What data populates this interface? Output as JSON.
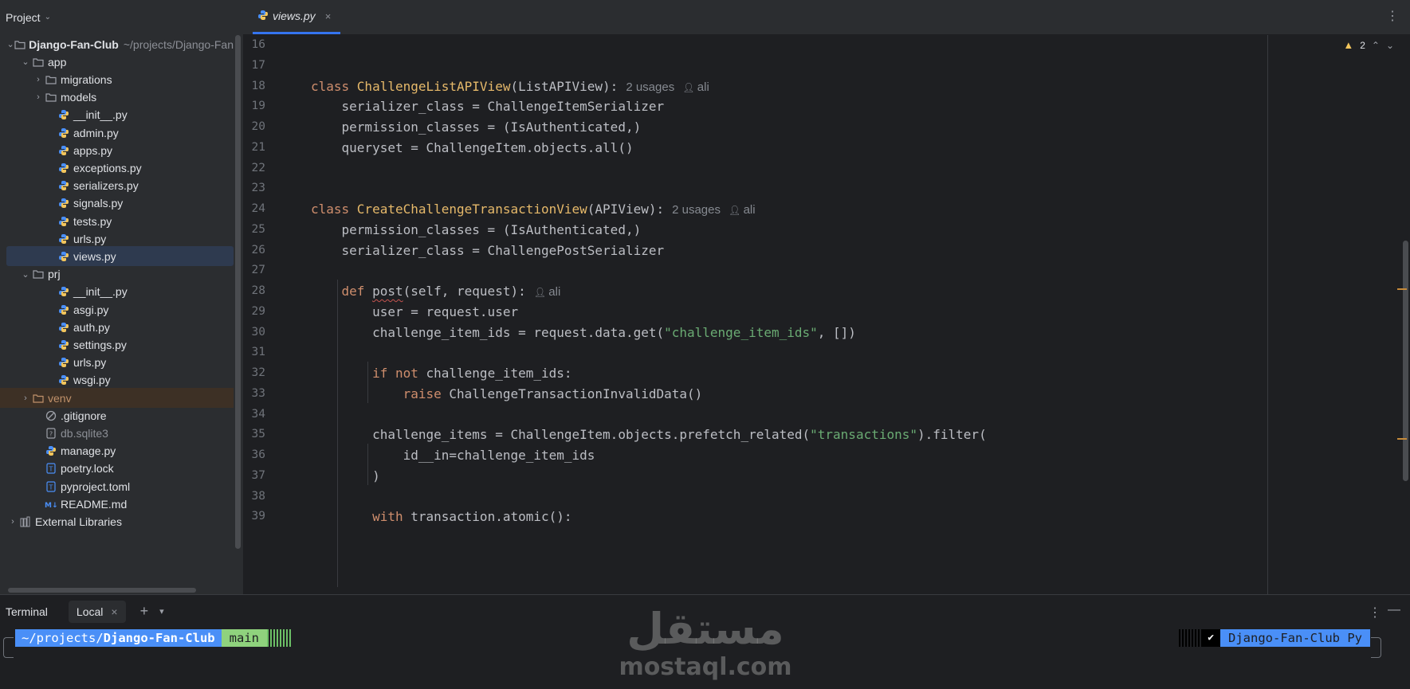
{
  "project_panel": {
    "title": "Project",
    "tree": [
      {
        "label": "Django-Fan-Club",
        "path": "~/projects/Django-Fan",
        "type": "folder",
        "expanded": true,
        "indent": 0
      },
      {
        "label": "app",
        "type": "folder",
        "expanded": true,
        "indent": 1
      },
      {
        "label": "migrations",
        "type": "folder",
        "expanded": false,
        "indent": 2
      },
      {
        "label": "models",
        "type": "folder",
        "expanded": false,
        "indent": 2
      },
      {
        "label": "__init__.py",
        "type": "python",
        "indent": 3
      },
      {
        "label": "admin.py",
        "type": "python",
        "indent": 3
      },
      {
        "label": "apps.py",
        "type": "python",
        "indent": 3
      },
      {
        "label": "exceptions.py",
        "type": "python",
        "indent": 3
      },
      {
        "label": "serializers.py",
        "type": "python",
        "indent": 3
      },
      {
        "label": "signals.py",
        "type": "python",
        "indent": 3
      },
      {
        "label": "tests.py",
        "type": "python",
        "indent": 3
      },
      {
        "label": "urls.py",
        "type": "python",
        "indent": 3
      },
      {
        "label": "views.py",
        "type": "python",
        "indent": 3,
        "selected": true
      },
      {
        "label": "prj",
        "type": "folder",
        "expanded": true,
        "indent": 1
      },
      {
        "label": "__init__.py",
        "type": "python",
        "indent": 3
      },
      {
        "label": "asgi.py",
        "type": "python",
        "indent": 3
      },
      {
        "label": "auth.py",
        "type": "python",
        "indent": 3
      },
      {
        "label": "settings.py",
        "type": "python",
        "indent": 3
      },
      {
        "label": "urls.py",
        "type": "python",
        "indent": 3
      },
      {
        "label": "wsgi.py",
        "type": "python",
        "indent": 3
      },
      {
        "label": "venv",
        "type": "excluded-folder",
        "expanded": false,
        "indent": 1
      },
      {
        "label": ".gitignore",
        "type": "ignore",
        "indent": 2
      },
      {
        "label": "db.sqlite3",
        "type": "db",
        "indent": 2
      },
      {
        "label": "manage.py",
        "type": "python",
        "indent": 2
      },
      {
        "label": "poetry.lock",
        "type": "text",
        "indent": 2
      },
      {
        "label": "pyproject.toml",
        "type": "text",
        "indent": 2
      },
      {
        "label": "README.md",
        "type": "markdown",
        "indent": 2
      },
      {
        "label": "External Libraries",
        "type": "libraries",
        "expanded": false,
        "indent": 0
      }
    ]
  },
  "editor": {
    "tab": {
      "label": "views.py",
      "close": "×"
    },
    "inspection": {
      "icon": "warning-icon",
      "count": "2"
    },
    "lines": [
      {
        "n": "16",
        "tokens": []
      },
      {
        "n": "17",
        "tokens": []
      },
      {
        "n": "18",
        "tokens": [
          [
            "kw",
            "class "
          ],
          [
            "cls",
            "ChallengeListAPIView"
          ],
          [
            "t",
            "(ListAPIView):"
          ],
          [
            "hint",
            "2 usages"
          ],
          [
            "author",
            "ali"
          ]
        ]
      },
      {
        "n": "19",
        "tokens": [
          [
            "t",
            "    serializer_class = ChallengeItemSerializer"
          ]
        ]
      },
      {
        "n": "20",
        "tokens": [
          [
            "t",
            "    permission_classes = (IsAuthenticated,)"
          ]
        ]
      },
      {
        "n": "21",
        "tokens": [
          [
            "t",
            "    queryset = ChallengeItem.objects.all()"
          ]
        ]
      },
      {
        "n": "22",
        "tokens": []
      },
      {
        "n": "23",
        "tokens": []
      },
      {
        "n": "24",
        "tokens": [
          [
            "kw",
            "class "
          ],
          [
            "cls",
            "CreateChallengeTransactionView"
          ],
          [
            "t",
            "(APIView):"
          ],
          [
            "hint",
            "2 usages"
          ],
          [
            "author",
            "ali"
          ]
        ]
      },
      {
        "n": "25",
        "tokens": [
          [
            "t",
            "    permission_classes = (IsAuthenticated,)"
          ]
        ]
      },
      {
        "n": "26",
        "tokens": [
          [
            "t",
            "    serializer_class = ChallengePostSerializer"
          ]
        ]
      },
      {
        "n": "27",
        "tokens": []
      },
      {
        "n": "28",
        "tokens": [
          [
            "t",
            "    "
          ],
          [
            "kw",
            "def "
          ],
          [
            "ul",
            "post"
          ],
          [
            "t",
            "(self, request):"
          ],
          [
            "author",
            "ali"
          ]
        ]
      },
      {
        "n": "29",
        "tokens": [
          [
            "t",
            "        user = request.user"
          ]
        ]
      },
      {
        "n": "30",
        "tokens": [
          [
            "t",
            "        challenge_item_ids = request.data.get("
          ],
          [
            "str",
            "\"challenge_item_ids\""
          ],
          [
            "t",
            ", [])"
          ]
        ]
      },
      {
        "n": "31",
        "tokens": []
      },
      {
        "n": "32",
        "tokens": [
          [
            "t",
            "        "
          ],
          [
            "kw",
            "if not "
          ],
          [
            "t",
            "challenge_item_ids:"
          ]
        ]
      },
      {
        "n": "33",
        "tokens": [
          [
            "t",
            "            "
          ],
          [
            "kw",
            "raise "
          ],
          [
            "t",
            "ChallengeTransactionInvalidData()"
          ]
        ]
      },
      {
        "n": "34",
        "tokens": []
      },
      {
        "n": "35",
        "tokens": [
          [
            "t",
            "        challenge_items = ChallengeItem.objects.prefetch_related("
          ],
          [
            "str",
            "\"transactions\""
          ],
          [
            "t",
            ").filter("
          ]
        ]
      },
      {
        "n": "36",
        "tokens": [
          [
            "t",
            "            id__in=challenge_item_ids"
          ]
        ]
      },
      {
        "n": "37",
        "tokens": [
          [
            "t",
            "        )"
          ]
        ]
      },
      {
        "n": "38",
        "tokens": []
      },
      {
        "n": "39",
        "tokens": [
          [
            "t",
            "        "
          ],
          [
            "kw",
            "with "
          ],
          [
            "t",
            "transaction.atomic():"
          ]
        ]
      }
    ]
  },
  "terminal": {
    "title": "Terminal",
    "tab_label": "Local",
    "tab_close": "×",
    "add": "+",
    "prompt_path_prefix": "~/projects/",
    "prompt_path_dir": "Django-Fan-Club",
    "prompt_branch": "main",
    "status_check": "✔",
    "env_label": "Django-Fan-Club Py"
  },
  "watermark": {
    "arabic": "مستقل",
    "latin": "mostaql.com"
  }
}
